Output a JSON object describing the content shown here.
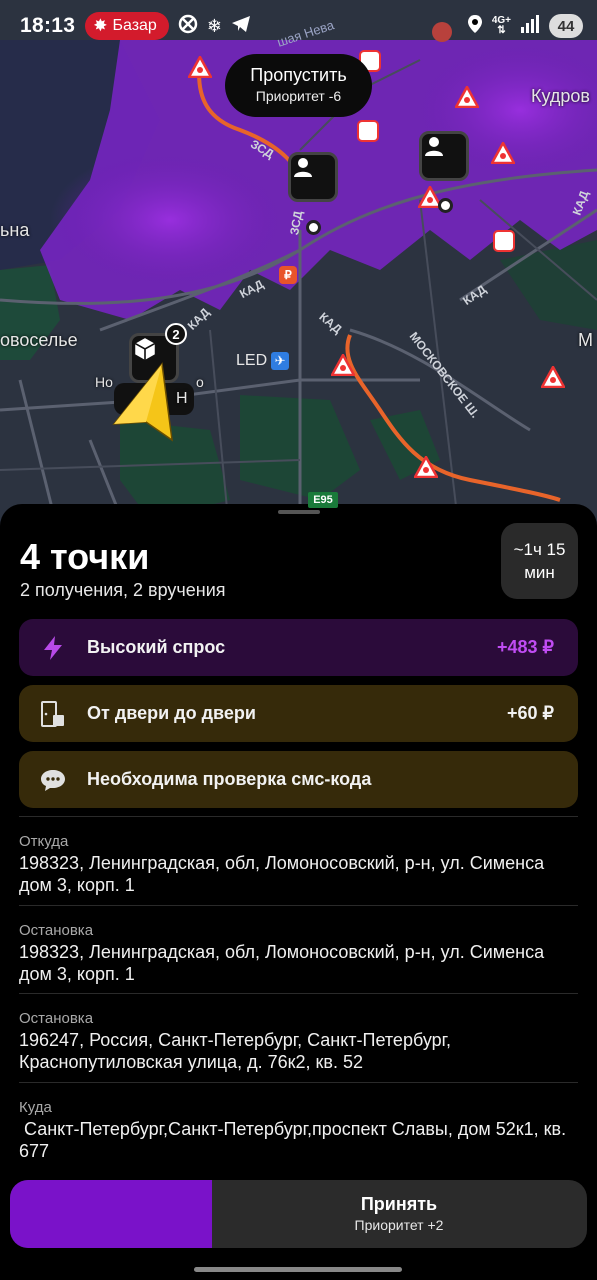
{
  "status_bar": {
    "time": "18:13",
    "bazar_label": "Базар",
    "network": "4G+",
    "battery": "44",
    "icons": [
      "star-burst-icon",
      "crossed-circle-icon",
      "snowflake-icon",
      "telegram-icon",
      "location-icon",
      "signal-icon"
    ]
  },
  "map": {
    "skip_bubble": {
      "title": "Пропустить",
      "subtitle": "Приоритет -6"
    },
    "labels": {
      "kudrovo": "Кудров",
      "novoselye": "овоселье",
      "left_edge": "ьна",
      "led": "LED",
      "highway": "E95",
      "right_edge": "М",
      "partial_city": "Но",
      "partial_city2": "о",
      "partial_city3": "Н",
      "road_kad_1": "КАД",
      "road_kad_2": "КАД",
      "road_kad_3": "КАД",
      "road_kad_4": "КАД",
      "road_kad_5": "КАД",
      "road_zsd_1": "ЗСД",
      "road_zsd_2": "ЗСД",
      "moskovskoe": "МОСКОВСКОЕ Ш.",
      "neva": "шая Нева"
    },
    "cluster_badge": "2",
    "colors": {
      "demand_overlay": "#8a2be2",
      "route": "#e8642a",
      "background": "#2c3340"
    }
  },
  "order": {
    "title": "4 точки",
    "subtitle": "2 получения, 2 вручения",
    "eta": {
      "line1": "~1ч 15",
      "line2": "мин"
    },
    "banners": [
      {
        "icon": "lightning-icon",
        "label": "Высокий спрос",
        "amount": "+483 ₽"
      },
      {
        "icon": "door-package-icon",
        "label": "От двери до двери",
        "amount": "+60 ₽"
      },
      {
        "icon": "chat-bubble-icon",
        "label": "Необходима проверка смс-кода"
      }
    ],
    "addresses": [
      {
        "label": "Откуда",
        "value": "198323, Ленинградская, обл, Ломоносовский, р-н, ул. Сименса дом 3, корп. 1"
      },
      {
        "label": "Остановка",
        "value": "198323, Ленинградская, обл, Ломоносовский, р-н, ул. Сименса дом 3, корп. 1"
      },
      {
        "label": "Остановка",
        "value": "196247, Россия, Санкт-Петербург, Санкт-Петербург, Краснопутиловская улица, д. 76к2, кв. 52"
      },
      {
        "label": "Куда",
        "value": " Санкт-Петербург,Санкт-Петербург,проспект Славы, дом 52к1, кв. 677"
      }
    ],
    "accept": {
      "title": "Принять",
      "subtitle": "Приоритет +2",
      "progress": 0.35
    }
  }
}
